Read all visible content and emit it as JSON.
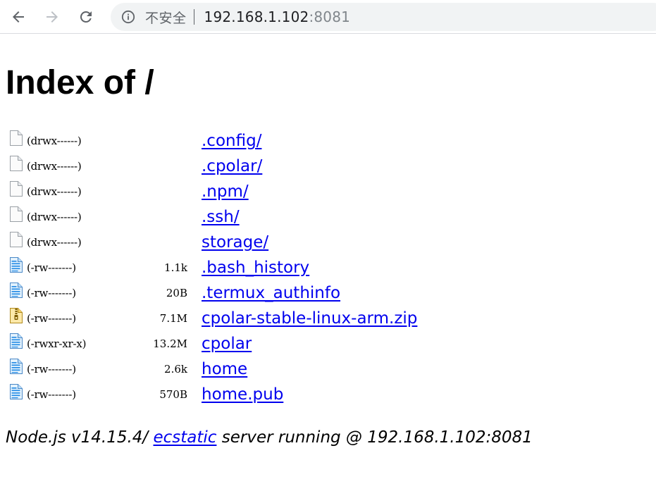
{
  "browser": {
    "security_label": "不安全",
    "url_host": "192.168.1.102",
    "url_port": ":8081"
  },
  "page": {
    "title": "Index of /",
    "entries": [
      {
        "icon": "folder-blank",
        "perms": "(drwx------)",
        "size": "",
        "name": ".config/"
      },
      {
        "icon": "folder-blank",
        "perms": "(drwx------)",
        "size": "",
        "name": ".cpolar/"
      },
      {
        "icon": "folder-blank",
        "perms": "(drwx------)",
        "size": "",
        "name": ".npm/"
      },
      {
        "icon": "folder-blank",
        "perms": "(drwx------)",
        "size": "",
        "name": ".ssh/"
      },
      {
        "icon": "folder-blank",
        "perms": "(drwx------)",
        "size": "",
        "name": "storage/"
      },
      {
        "icon": "text-file",
        "perms": "(-rw-------)",
        "size": "1.1k",
        "name": ".bash_history"
      },
      {
        "icon": "text-file",
        "perms": "(-rw-------)",
        "size": "20B",
        "name": ".termux_authinfo"
      },
      {
        "icon": "zip-file",
        "perms": "(-rw-------)",
        "size": "7.1M",
        "name": "cpolar-stable-linux-arm.zip"
      },
      {
        "icon": "text-file",
        "perms": "(-rwxr-xr-x)",
        "size": "13.2M",
        "name": "cpolar"
      },
      {
        "icon": "text-file",
        "perms": "(-rw-------)",
        "size": "2.6k",
        "name": "home"
      },
      {
        "icon": "text-file",
        "perms": "(-rw-------)",
        "size": "570B",
        "name": "home.pub"
      }
    ],
    "footer": {
      "prefix": "Node.js v14.15.4/ ",
      "link": "ecstatic",
      "suffix": " server running @ 192.168.1.102:8081"
    }
  }
}
